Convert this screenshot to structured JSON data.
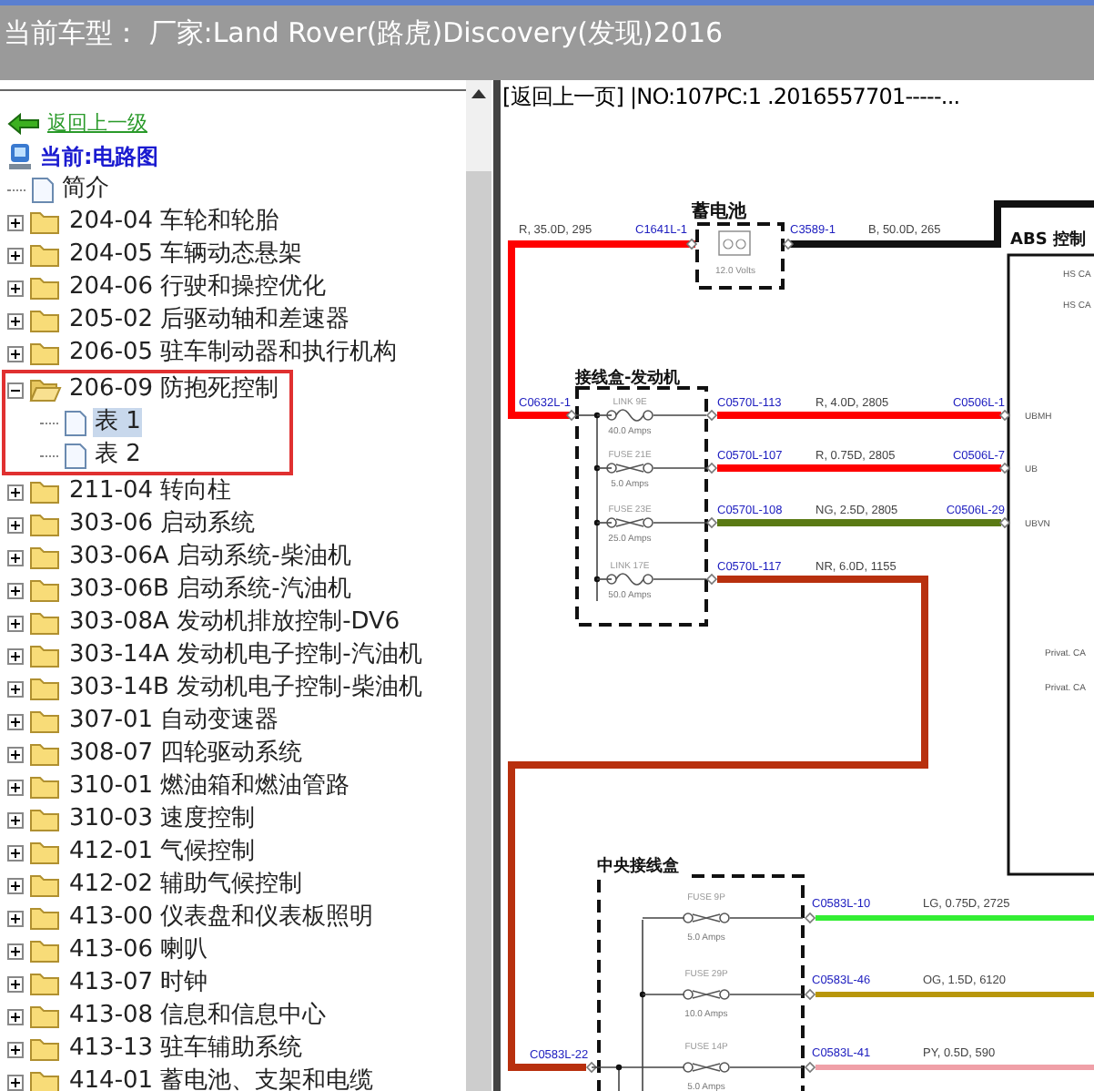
{
  "title_bar": {
    "text": "当前车型： 厂家:Land Rover(路虎)Discovery(发现)2016"
  },
  "tree_panel": {
    "back_link": "返回上一级",
    "current": "当前:电路图",
    "items": [
      {
        "kind": "document",
        "label": "简介",
        "selected": false
      },
      {
        "kind": "folder",
        "label": "204-04 车轮和轮胎",
        "expanded": false
      },
      {
        "kind": "folder",
        "label": "204-05 车辆动态悬架",
        "expanded": false
      },
      {
        "kind": "folder",
        "label": "204-06 行驶和操控优化",
        "expanded": false
      },
      {
        "kind": "folder",
        "label": "205-02 后驱动轴和差速器",
        "expanded": false
      },
      {
        "kind": "folder",
        "label": "206-05 驻车制动器和执行机构",
        "expanded": false
      },
      {
        "kind": "folder",
        "label": "206-09 防抱死控制",
        "expanded": true,
        "highlighted": true,
        "children": [
          {
            "kind": "document",
            "label": "表 1",
            "selected": true
          },
          {
            "kind": "document",
            "label": "表 2",
            "selected": false
          }
        ]
      },
      {
        "kind": "folder",
        "label": "211-04 转向柱",
        "expanded": false
      },
      {
        "kind": "folder",
        "label": "303-06 启动系统",
        "expanded": false
      },
      {
        "kind": "folder",
        "label": "303-06A 启动系统-柴油机",
        "expanded": false
      },
      {
        "kind": "folder",
        "label": "303-06B 启动系统-汽油机",
        "expanded": false
      },
      {
        "kind": "folder",
        "label": "303-08A 发动机排放控制-DV6",
        "expanded": false
      },
      {
        "kind": "folder",
        "label": "303-14A 发动机电子控制-汽油机",
        "expanded": false
      },
      {
        "kind": "folder",
        "label": "303-14B 发动机电子控制-柴油机",
        "expanded": false
      },
      {
        "kind": "folder",
        "label": "307-01 自动变速器",
        "expanded": false
      },
      {
        "kind": "folder",
        "label": "308-07 四轮驱动系统",
        "expanded": false
      },
      {
        "kind": "folder",
        "label": "310-01 燃油箱和燃油管路",
        "expanded": false
      },
      {
        "kind": "folder",
        "label": "310-03 速度控制",
        "expanded": false
      },
      {
        "kind": "folder",
        "label": "412-01 气候控制",
        "expanded": false
      },
      {
        "kind": "folder",
        "label": "412-02 辅助气候控制",
        "expanded": false
      },
      {
        "kind": "folder",
        "label": "413-00 仪表盘和仪表板照明",
        "expanded": false
      },
      {
        "kind": "folder",
        "label": "413-06 喇叭",
        "expanded": false
      },
      {
        "kind": "folder",
        "label": "413-07 时钟",
        "expanded": false
      },
      {
        "kind": "folder",
        "label": "413-08 信息和信息中心",
        "expanded": false
      },
      {
        "kind": "folder",
        "label": "413-13 驻车辅助系统",
        "expanded": false
      },
      {
        "kind": "folder",
        "label": "414-01 蓄电池、支架和电缆",
        "expanded": false
      }
    ]
  },
  "diagram_panel": {
    "header": "[返回上一页] |NO:107PC:1 .2016557701-----...",
    "battery": {
      "title": "蓄电池",
      "rating": "12.0 Volts",
      "left_connector": "C1641L-1",
      "right_connector": "C3589-1",
      "left_wire": "R, 35.0D, 295",
      "right_wire": "B, 50.0D, 265"
    },
    "abs_module": {
      "title": "ABS 控制",
      "pins": [
        "HS CA",
        "HS CA",
        "Privat. CA",
        "Privat. CA"
      ]
    },
    "engine_junction_box": {
      "title": "接线盒-发动机",
      "input_connector": "C0632L-1",
      "fuses": [
        {
          "kind": "link",
          "name": "LINK 9E",
          "rating": "40.0 Amps",
          "connector": "C0570L-113",
          "wire": "R, 4.0D, 2805",
          "color": "#ff0000",
          "end_connector": "C0506L-1",
          "pin": "UBMH"
        },
        {
          "kind": "fuse",
          "name": "FUSE 21E",
          "rating": "5.0 Amps",
          "connector": "C0570L-107",
          "wire": "R, 0.75D, 2805",
          "color": "#ff0000",
          "end_connector": "C0506L-7",
          "pin": "UB"
        },
        {
          "kind": "fuse",
          "name": "FUSE 23E",
          "rating": "25.0 Amps",
          "connector": "C0570L-108",
          "wire": "NG, 2.5D, 2805",
          "color": "#5a7a14",
          "end_connector": "C0506L-29",
          "pin": "UBVN"
        },
        {
          "kind": "link",
          "name": "LINK 17E",
          "rating": "50.0 Amps",
          "connector": "C0570L-117",
          "wire": "NR, 6.0D, 1155",
          "color": "#b8300e"
        }
      ]
    },
    "central_junction_box": {
      "title": "中央接线盒",
      "input_connector": "C0583L-22",
      "fuses": [
        {
          "kind": "fuse",
          "name": "FUSE 9P",
          "rating": "5.0 Amps",
          "connector": "C0583L-10",
          "wire": "LG, 0.75D, 2725",
          "color": "#33ee33"
        },
        {
          "kind": "fuse",
          "name": "FUSE 29P",
          "rating": "10.0 Amps",
          "connector": "C0583L-46",
          "wire": "OG, 1.5D, 6120",
          "color": "#b8960a"
        },
        {
          "kind": "fuse",
          "name": "FUSE 14P",
          "rating": "5.0 Amps",
          "connector": "C0583L-41",
          "wire": "PY, 0.5D, 590",
          "color": "#f0a0a8"
        }
      ]
    }
  }
}
